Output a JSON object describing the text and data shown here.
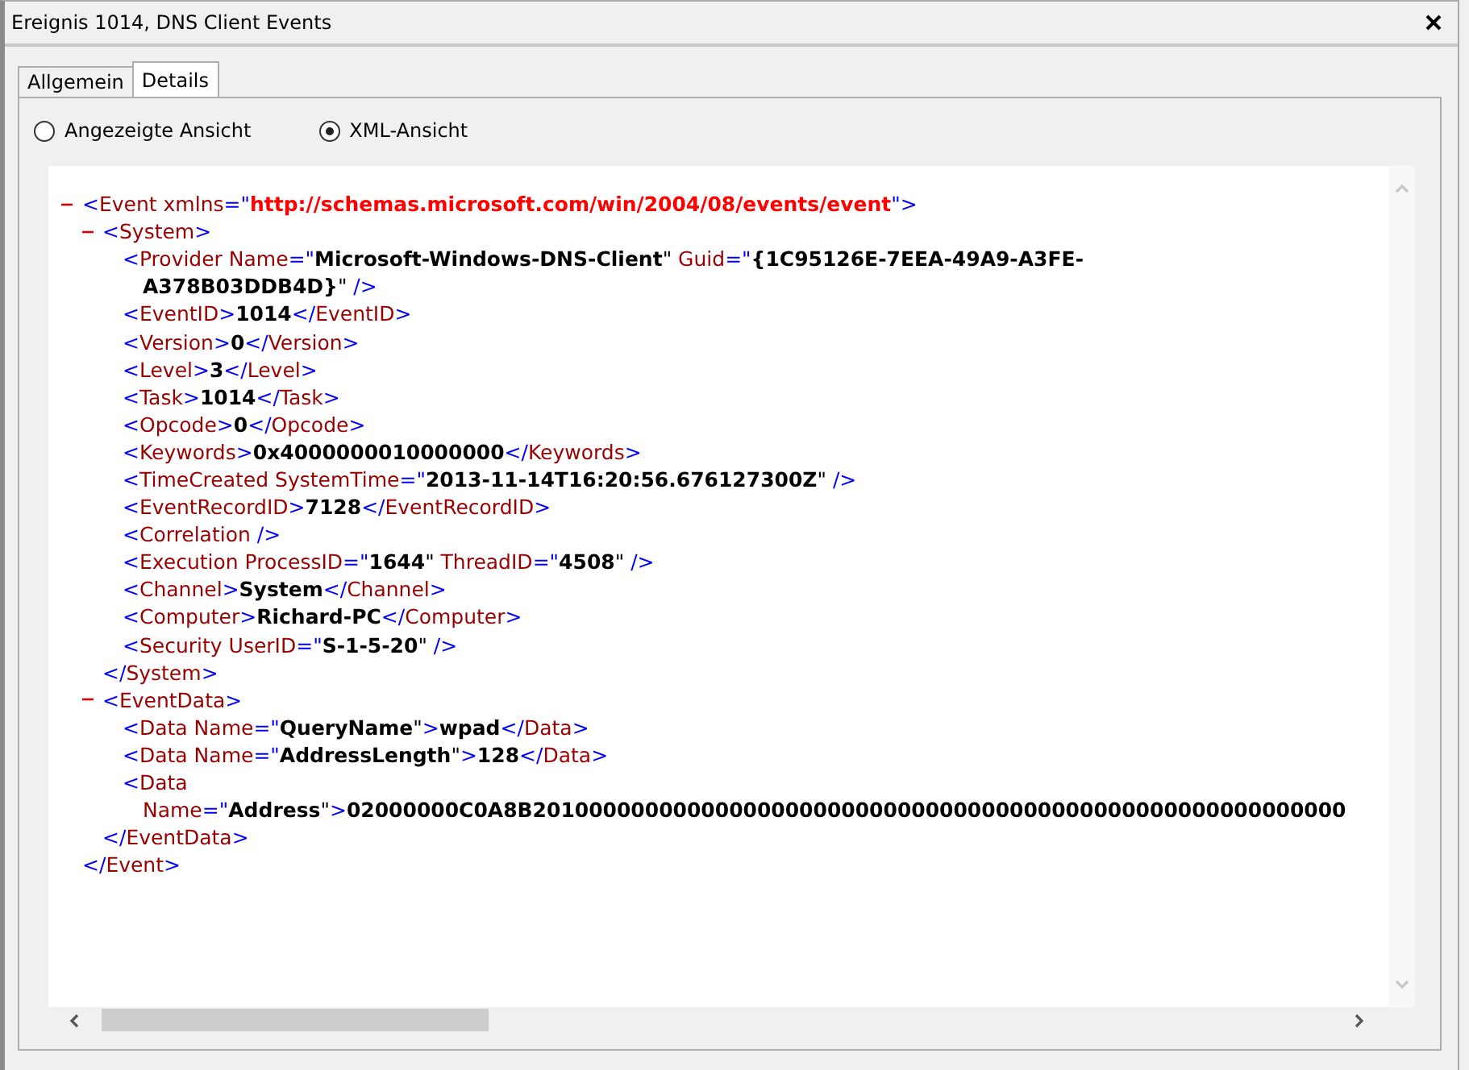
{
  "window": {
    "title": "Ereignis 1014, DNS Client Events"
  },
  "tabs": [
    {
      "label": "Allgemein",
      "selected": false
    },
    {
      "label": "Details",
      "selected": true
    }
  ],
  "views": [
    {
      "label": "Angezeigte Ansicht",
      "selected": false
    },
    {
      "label": "XML-Ansicht",
      "selected": true
    }
  ],
  "xml_tree": [
    {
      "expanded": true,
      "lines": [
        [
          {
            "kind": "punct",
            "text": "<"
          },
          {
            "kind": "name",
            "text": "Event xmlns"
          },
          {
            "kind": "punct",
            "text": "=\""
          },
          {
            "kind": "link",
            "text": "http://schemas.microsoft.com/win/2004/08/events/event"
          },
          {
            "kind": "punct",
            "text": "\">"
          }
        ]
      ],
      "end": [
        {
          "kind": "punct",
          "text": "</"
        },
        {
          "kind": "name",
          "text": "Event"
        },
        {
          "kind": "punct",
          "text": ">"
        }
      ],
      "children": [
        {
          "expanded": true,
          "lines": [
            [
              {
                "kind": "punct",
                "text": "<"
              },
              {
                "kind": "name",
                "text": "System"
              },
              {
                "kind": "punct",
                "text": ">"
              }
            ]
          ],
          "end": [
            {
              "kind": "punct",
              "text": "</"
            },
            {
              "kind": "name",
              "text": "System"
            },
            {
              "kind": "punct",
              "text": ">"
            }
          ],
          "children": [
            {
              "lines": [
                [
                  {
                    "kind": "punct",
                    "text": "<"
                  },
                  {
                    "kind": "name",
                    "text": "Provider Name"
                  },
                  {
                    "kind": "punct",
                    "text": "=\""
                  },
                  {
                    "kind": "value",
                    "text": "Microsoft-Windows-DNS-Client"
                  },
                  {
                    "kind": "quote",
                    "text": "\""
                  },
                  {
                    "kind": "name",
                    "text": " Guid"
                  },
                  {
                    "kind": "punct",
                    "text": "=\""
                  },
                  {
                    "kind": "value",
                    "text": "{1C95126E-7EEA-49A9-A3FE-"
                  }
                ],
                [
                  {
                    "kind": "value",
                    "text": "A378B03DDB4D}"
                  },
                  {
                    "kind": "quote",
                    "text": "\""
                  },
                  {
                    "kind": "punct",
                    "text": " />"
                  }
                ]
              ]
            },
            {
              "lines": [
                [
                  {
                    "kind": "punct",
                    "text": "<"
                  },
                  {
                    "kind": "name",
                    "text": "EventID"
                  },
                  {
                    "kind": "punct",
                    "text": ">"
                  },
                  {
                    "kind": "value",
                    "text": "1014"
                  },
                  {
                    "kind": "punct",
                    "text": "</"
                  },
                  {
                    "kind": "name",
                    "text": "EventID"
                  },
                  {
                    "kind": "punct",
                    "text": ">"
                  }
                ]
              ]
            },
            {
              "lines": [
                [
                  {
                    "kind": "punct",
                    "text": "<"
                  },
                  {
                    "kind": "name",
                    "text": "Version"
                  },
                  {
                    "kind": "punct",
                    "text": ">"
                  },
                  {
                    "kind": "value",
                    "text": "0"
                  },
                  {
                    "kind": "punct",
                    "text": "</"
                  },
                  {
                    "kind": "name",
                    "text": "Version"
                  },
                  {
                    "kind": "punct",
                    "text": ">"
                  }
                ]
              ]
            },
            {
              "lines": [
                [
                  {
                    "kind": "punct",
                    "text": "<"
                  },
                  {
                    "kind": "name",
                    "text": "Level"
                  },
                  {
                    "kind": "punct",
                    "text": ">"
                  },
                  {
                    "kind": "value",
                    "text": "3"
                  },
                  {
                    "kind": "punct",
                    "text": "</"
                  },
                  {
                    "kind": "name",
                    "text": "Level"
                  },
                  {
                    "kind": "punct",
                    "text": ">"
                  }
                ]
              ]
            },
            {
              "lines": [
                [
                  {
                    "kind": "punct",
                    "text": "<"
                  },
                  {
                    "kind": "name",
                    "text": "Task"
                  },
                  {
                    "kind": "punct",
                    "text": ">"
                  },
                  {
                    "kind": "value",
                    "text": "1014"
                  },
                  {
                    "kind": "punct",
                    "text": "</"
                  },
                  {
                    "kind": "name",
                    "text": "Task"
                  },
                  {
                    "kind": "punct",
                    "text": ">"
                  }
                ]
              ]
            },
            {
              "lines": [
                [
                  {
                    "kind": "punct",
                    "text": "<"
                  },
                  {
                    "kind": "name",
                    "text": "Opcode"
                  },
                  {
                    "kind": "punct",
                    "text": ">"
                  },
                  {
                    "kind": "value",
                    "text": "0"
                  },
                  {
                    "kind": "punct",
                    "text": "</"
                  },
                  {
                    "kind": "name",
                    "text": "Opcode"
                  },
                  {
                    "kind": "punct",
                    "text": ">"
                  }
                ]
              ]
            },
            {
              "lines": [
                [
                  {
                    "kind": "punct",
                    "text": "<"
                  },
                  {
                    "kind": "name",
                    "text": "Keywords"
                  },
                  {
                    "kind": "punct",
                    "text": ">"
                  },
                  {
                    "kind": "value",
                    "text": "0x4000000010000000"
                  },
                  {
                    "kind": "punct",
                    "text": "</"
                  },
                  {
                    "kind": "name",
                    "text": "Keywords"
                  },
                  {
                    "kind": "punct",
                    "text": ">"
                  }
                ]
              ]
            },
            {
              "lines": [
                [
                  {
                    "kind": "punct",
                    "text": "<"
                  },
                  {
                    "kind": "name",
                    "text": "TimeCreated SystemTime"
                  },
                  {
                    "kind": "punct",
                    "text": "=\""
                  },
                  {
                    "kind": "value",
                    "text": "2013-11-14T16:20:56.676127300Z"
                  },
                  {
                    "kind": "quote",
                    "text": "\""
                  },
                  {
                    "kind": "punct",
                    "text": " />"
                  }
                ]
              ]
            },
            {
              "lines": [
                [
                  {
                    "kind": "punct",
                    "text": "<"
                  },
                  {
                    "kind": "name",
                    "text": "EventRecordID"
                  },
                  {
                    "kind": "punct",
                    "text": ">"
                  },
                  {
                    "kind": "value",
                    "text": "7128"
                  },
                  {
                    "kind": "punct",
                    "text": "</"
                  },
                  {
                    "kind": "name",
                    "text": "EventRecordID"
                  },
                  {
                    "kind": "punct",
                    "text": ">"
                  }
                ]
              ]
            },
            {
              "lines": [
                [
                  {
                    "kind": "punct",
                    "text": "<"
                  },
                  {
                    "kind": "name",
                    "text": "Correlation"
                  },
                  {
                    "kind": "punct",
                    "text": " />"
                  }
                ]
              ]
            },
            {
              "lines": [
                [
                  {
                    "kind": "punct",
                    "text": "<"
                  },
                  {
                    "kind": "name",
                    "text": "Execution ProcessID"
                  },
                  {
                    "kind": "punct",
                    "text": "=\""
                  },
                  {
                    "kind": "value",
                    "text": "1644"
                  },
                  {
                    "kind": "quote",
                    "text": "\""
                  },
                  {
                    "kind": "name",
                    "text": " ThreadID"
                  },
                  {
                    "kind": "punct",
                    "text": "=\""
                  },
                  {
                    "kind": "value",
                    "text": "4508"
                  },
                  {
                    "kind": "quote",
                    "text": "\""
                  },
                  {
                    "kind": "punct",
                    "text": " />"
                  }
                ]
              ]
            },
            {
              "lines": [
                [
                  {
                    "kind": "punct",
                    "text": "<"
                  },
                  {
                    "kind": "name",
                    "text": "Channel"
                  },
                  {
                    "kind": "punct",
                    "text": ">"
                  },
                  {
                    "kind": "value",
                    "text": "System"
                  },
                  {
                    "kind": "punct",
                    "text": "</"
                  },
                  {
                    "kind": "name",
                    "text": "Channel"
                  },
                  {
                    "kind": "punct",
                    "text": ">"
                  }
                ]
              ]
            },
            {
              "lines": [
                [
                  {
                    "kind": "punct",
                    "text": "<"
                  },
                  {
                    "kind": "name",
                    "text": "Computer"
                  },
                  {
                    "kind": "punct",
                    "text": ">"
                  },
                  {
                    "kind": "value",
                    "text": "Richard-PC"
                  },
                  {
                    "kind": "punct",
                    "text": "</"
                  },
                  {
                    "kind": "name",
                    "text": "Computer"
                  },
                  {
                    "kind": "punct",
                    "text": ">"
                  }
                ]
              ]
            },
            {
              "lines": [
                [
                  {
                    "kind": "punct",
                    "text": "<"
                  },
                  {
                    "kind": "name",
                    "text": "Security UserID"
                  },
                  {
                    "kind": "punct",
                    "text": "=\""
                  },
                  {
                    "kind": "value",
                    "text": "S-1-5-20"
                  },
                  {
                    "kind": "quote",
                    "text": "\""
                  },
                  {
                    "kind": "punct",
                    "text": " />"
                  }
                ]
              ]
            }
          ]
        },
        {
          "expanded": true,
          "lines": [
            [
              {
                "kind": "punct",
                "text": "<"
              },
              {
                "kind": "name",
                "text": "EventData"
              },
              {
                "kind": "punct",
                "text": ">"
              }
            ]
          ],
          "end": [
            {
              "kind": "punct",
              "text": "</"
            },
            {
              "kind": "name",
              "text": "EventData"
            },
            {
              "kind": "punct",
              "text": ">"
            }
          ],
          "children": [
            {
              "lines": [
                [
                  {
                    "kind": "punct",
                    "text": "<"
                  },
                  {
                    "kind": "name",
                    "text": "Data Name"
                  },
                  {
                    "kind": "punct",
                    "text": "=\""
                  },
                  {
                    "kind": "value",
                    "text": "QueryName"
                  },
                  {
                    "kind": "quote",
                    "text": "\""
                  },
                  {
                    "kind": "punct",
                    "text": ">"
                  },
                  {
                    "kind": "value",
                    "text": "wpad"
                  },
                  {
                    "kind": "punct",
                    "text": "</"
                  },
                  {
                    "kind": "name",
                    "text": "Data"
                  },
                  {
                    "kind": "punct",
                    "text": ">"
                  }
                ]
              ]
            },
            {
              "lines": [
                [
                  {
                    "kind": "punct",
                    "text": "<"
                  },
                  {
                    "kind": "name",
                    "text": "Data Name"
                  },
                  {
                    "kind": "punct",
                    "text": "=\""
                  },
                  {
                    "kind": "value",
                    "text": "AddressLength"
                  },
                  {
                    "kind": "quote",
                    "text": "\""
                  },
                  {
                    "kind": "punct",
                    "text": ">"
                  },
                  {
                    "kind": "value",
                    "text": "128"
                  },
                  {
                    "kind": "punct",
                    "text": "</"
                  },
                  {
                    "kind": "name",
                    "text": "Data"
                  },
                  {
                    "kind": "punct",
                    "text": ">"
                  }
                ]
              ]
            },
            {
              "lines": [
                [
                  {
                    "kind": "punct",
                    "text": "<"
                  },
                  {
                    "kind": "name",
                    "text": "Data"
                  }
                ],
                [
                  {
                    "kind": "name",
                    "text": "Name"
                  },
                  {
                    "kind": "punct",
                    "text": "=\""
                  },
                  {
                    "kind": "value",
                    "text": "Address"
                  },
                  {
                    "kind": "quote",
                    "text": "\""
                  },
                  {
                    "kind": "punct",
                    "text": ">"
                  },
                  {
                    "kind": "value",
                    "text": "02000000C0A8B2010000000000000000000000000000000000000000000000000000000"
                  }
                ]
              ]
            }
          ]
        }
      ]
    }
  ]
}
